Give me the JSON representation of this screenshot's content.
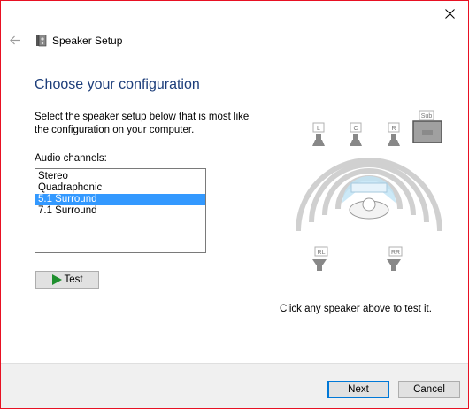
{
  "window": {
    "title": "Speaker Setup",
    "close_icon": "close-icon",
    "back_icon": "back-arrow-icon",
    "app_icon": "speaker-icon"
  },
  "page": {
    "heading": "Choose your configuration",
    "instructions": "Select the speaker setup below that is most like the configuration on your computer.",
    "channels_label": "Audio channels:",
    "channels": [
      {
        "label": "Stereo",
        "selected": false
      },
      {
        "label": "Quadraphonic",
        "selected": false
      },
      {
        "label": "5.1 Surround",
        "selected": true
      },
      {
        "label": "7.1 Surround",
        "selected": false
      }
    ],
    "test_label": "Test",
    "hint": "Click any speaker above to test it."
  },
  "diagram": {
    "speakers": [
      "L",
      "C",
      "R",
      "Sub",
      "RL",
      "RR"
    ]
  },
  "footer": {
    "next_label": "Next",
    "cancel_label": "Cancel"
  },
  "colors": {
    "accent": "#0078d7",
    "selection": "#3399ff",
    "heading": "#1c3d7a",
    "test_arrow": "#1e8f2e"
  }
}
